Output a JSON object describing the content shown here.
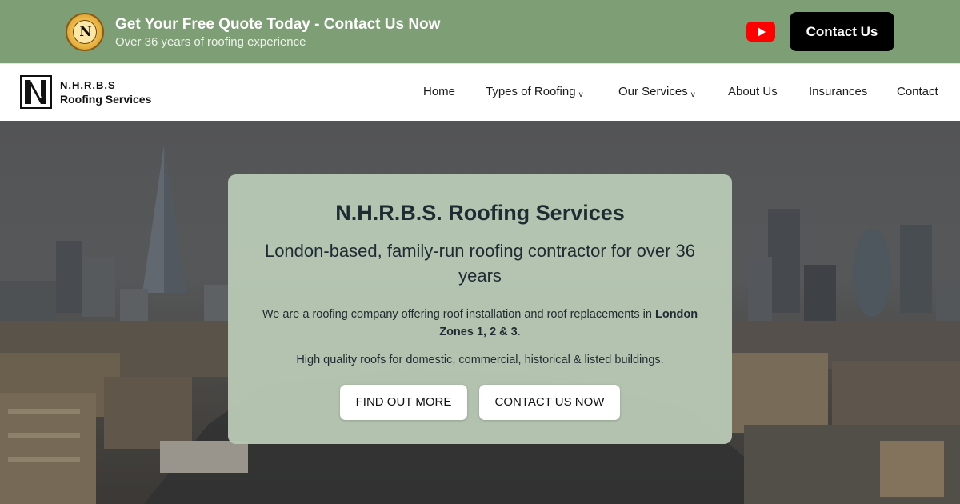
{
  "topbar": {
    "badge_logo": "N",
    "title": "Get Your Free Quote Today - Contact Us Now",
    "subtitle": "Over 36 years of roofing experience",
    "youtube_icon": "youtube-icon",
    "contact_label": "Contact Us",
    "background_color": "#7e9e75"
  },
  "brand": {
    "line1": "N.H.R.B.S",
    "line2": "Roofing Services"
  },
  "nav": {
    "home": "Home",
    "types": "Types of Roofing",
    "services": "Our Services",
    "about": "About Us",
    "insurances": "Insurances",
    "contact": "Contact",
    "dropdown_icon": "chevron-down-icon"
  },
  "hero": {
    "title": "N.H.R.B.S. Roofing Services",
    "subtitle": "London-based, family-run roofing contractor for over 36 years",
    "p1_before": "We are a roofing company offering roof installation and roof replacements in ",
    "p1_bold": "London Zones 1, 2 & 3",
    "p1_after": ".",
    "p2": "High quality roofs for domestic, commercial, historical & listed buildings.",
    "btn_find": "FIND OUT MORE",
    "btn_contact": "CONTACT US NOW",
    "card_color": "#b7c7b3"
  }
}
